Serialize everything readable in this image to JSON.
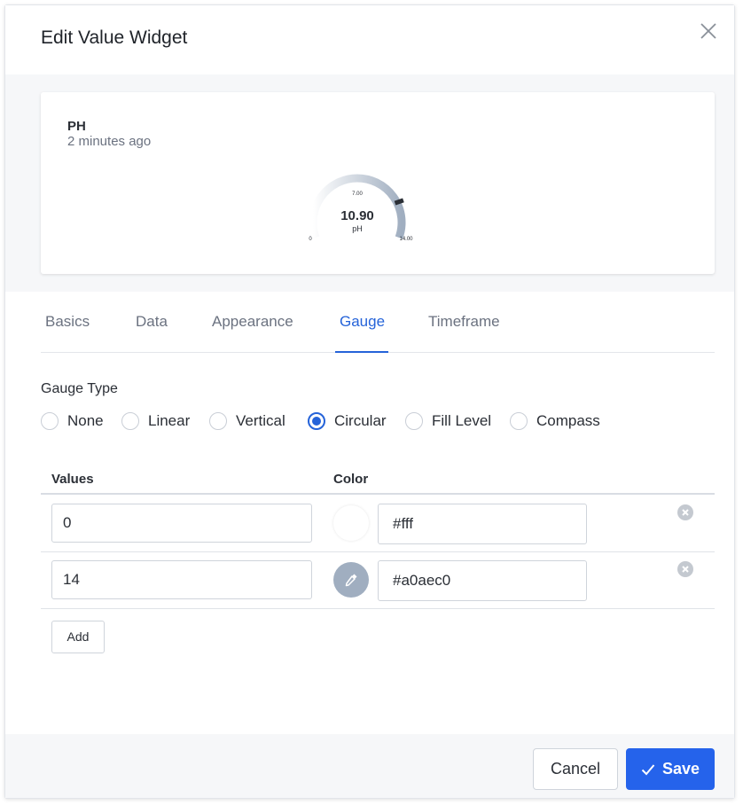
{
  "dialog": {
    "title": "Edit Value Widget",
    "close_icon": "close-icon"
  },
  "preview": {
    "title": "PH",
    "subtitle": "2 minutes ago",
    "gauge": {
      "type": "circular",
      "value": "10.90",
      "unit": "pH",
      "min_label": "0",
      "mid_label": "7.00",
      "max_label": "14.00",
      "value_number": 10.9,
      "min": 0,
      "max": 14
    }
  },
  "tabs": [
    {
      "label": "Basics",
      "active": false
    },
    {
      "label": "Data",
      "active": false
    },
    {
      "label": "Appearance",
      "active": false
    },
    {
      "label": "Gauge",
      "active": true
    },
    {
      "label": "Timeframe",
      "active": false
    }
  ],
  "gauge_type": {
    "label": "Gauge Type",
    "options": [
      {
        "label": "None",
        "checked": false
      },
      {
        "label": "Linear",
        "checked": false
      },
      {
        "label": "Vertical",
        "checked": false
      },
      {
        "label": "Circular",
        "checked": true
      },
      {
        "label": "Fill Level",
        "checked": false
      },
      {
        "label": "Compass",
        "checked": false
      }
    ]
  },
  "values_table": {
    "headers": {
      "values": "Values",
      "color": "Color"
    },
    "rows": [
      {
        "value": "0",
        "color": "#fff",
        "swatch_color": "#ffffff"
      },
      {
        "value": "14",
        "color": "#a0aec0",
        "swatch_color": "#a0aec0",
        "swatch_icon": "eyedropper-icon"
      }
    ],
    "add_label": "Add"
  },
  "footer": {
    "cancel_label": "Cancel",
    "save_label": "Save",
    "save_icon": "check-icon"
  },
  "colors": {
    "accent": "#2563d9",
    "save_button": "#2563eb",
    "gauge_start": "#ffffff",
    "gauge_end": "#a0aec0"
  }
}
